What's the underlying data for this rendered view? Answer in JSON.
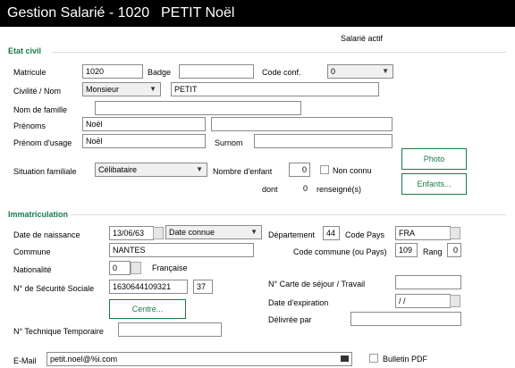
{
  "window": {
    "title": "Gestion Salarié - 1020",
    "name": "PETIT Noël"
  },
  "status": "Salarié actif",
  "etat_civil": {
    "section_title": "Etat civil",
    "matricule_label": "Matricule",
    "matricule": "1020",
    "badge_label": "Badge",
    "badge": "",
    "code_conf_label": "Code conf.",
    "code_conf": "0",
    "civilite_label": "Civilité /  Nom",
    "civilite": "Monsieur",
    "nom": "PETIT",
    "nom_famille_label": "Nom de famille",
    "nom_famille": "",
    "prenoms_label": "Prénoms",
    "prenom1": "Noël",
    "prenom2": "",
    "prenom_usage_label": "Prénom d'usage",
    "prenom_usage": "Noël",
    "surnom_label": "Surnom",
    "surnom": "",
    "situation_label": "Situation familiale",
    "situation": "Célibataire",
    "nb_enfant_label": "Nombre d'enfant",
    "nb_enfant": "0",
    "non_connu_label": "Non connu",
    "dont_label": "dont",
    "dont_value": "0",
    "renseignes_label": "renseigné(s)",
    "photo_button": "Photo",
    "enfants_button": "Enfants..."
  },
  "immatriculation": {
    "section_title": "Immatriculation",
    "naissance_label": "Date de naissance",
    "naissance": "13/06/63",
    "date_type": "Date connue",
    "departement_label": "Département",
    "departement": "44",
    "code_pays_label": "Code Pays",
    "code_pays": "FRA",
    "commune_label": "Commune",
    "commune": "NANTES",
    "code_commune_label": "Code commune (ou Pays)",
    "code_commune": "109",
    "rang_label": "Rang",
    "rang": "0",
    "nationalite_label": "Nationalité",
    "nationalite_code": "0",
    "nationalite": "Française",
    "secu_label": "N° de Sécurité Sociale",
    "secu": "1630644109321",
    "secu_cle": "37",
    "centre_button": "Centre...",
    "carte_label": "N° Carte de séjour / Travail",
    "carte": "",
    "expiration_label": "Date d'expiration",
    "expiration": " / /",
    "delivree_label": "Délivrée par",
    "delivree": "",
    "tech_label": "N° Technique Temporaire",
    "tech": ""
  },
  "email": {
    "label": "E-Mail",
    "value": "petit.noel@%i.com"
  },
  "bulletin_pdf_label": "Bulletin PDF"
}
